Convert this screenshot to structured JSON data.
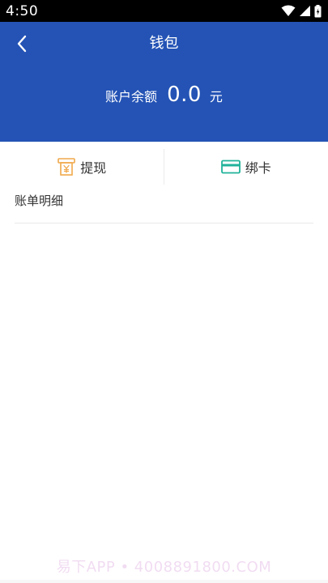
{
  "status_bar": {
    "time": "4:50",
    "icons": [
      "wifi-icon",
      "cellular-signal-icon",
      "battery-icon"
    ]
  },
  "header": {
    "title": "钱包",
    "back_icon": "chevron-left-icon",
    "background_color": "#2453b5",
    "balance": {
      "label": "账户余额",
      "value": "0.0",
      "unit": "元"
    }
  },
  "actions": [
    {
      "label": "提现",
      "icon": "withdraw-icon",
      "icon_color": "#f0a84b"
    },
    {
      "label": "绑卡",
      "icon": "bank-card-icon",
      "icon_color": "#20b39a"
    }
  ],
  "bills": {
    "title": "账单明细",
    "items": []
  },
  "watermark": "易下APP • 4008891800.COM"
}
